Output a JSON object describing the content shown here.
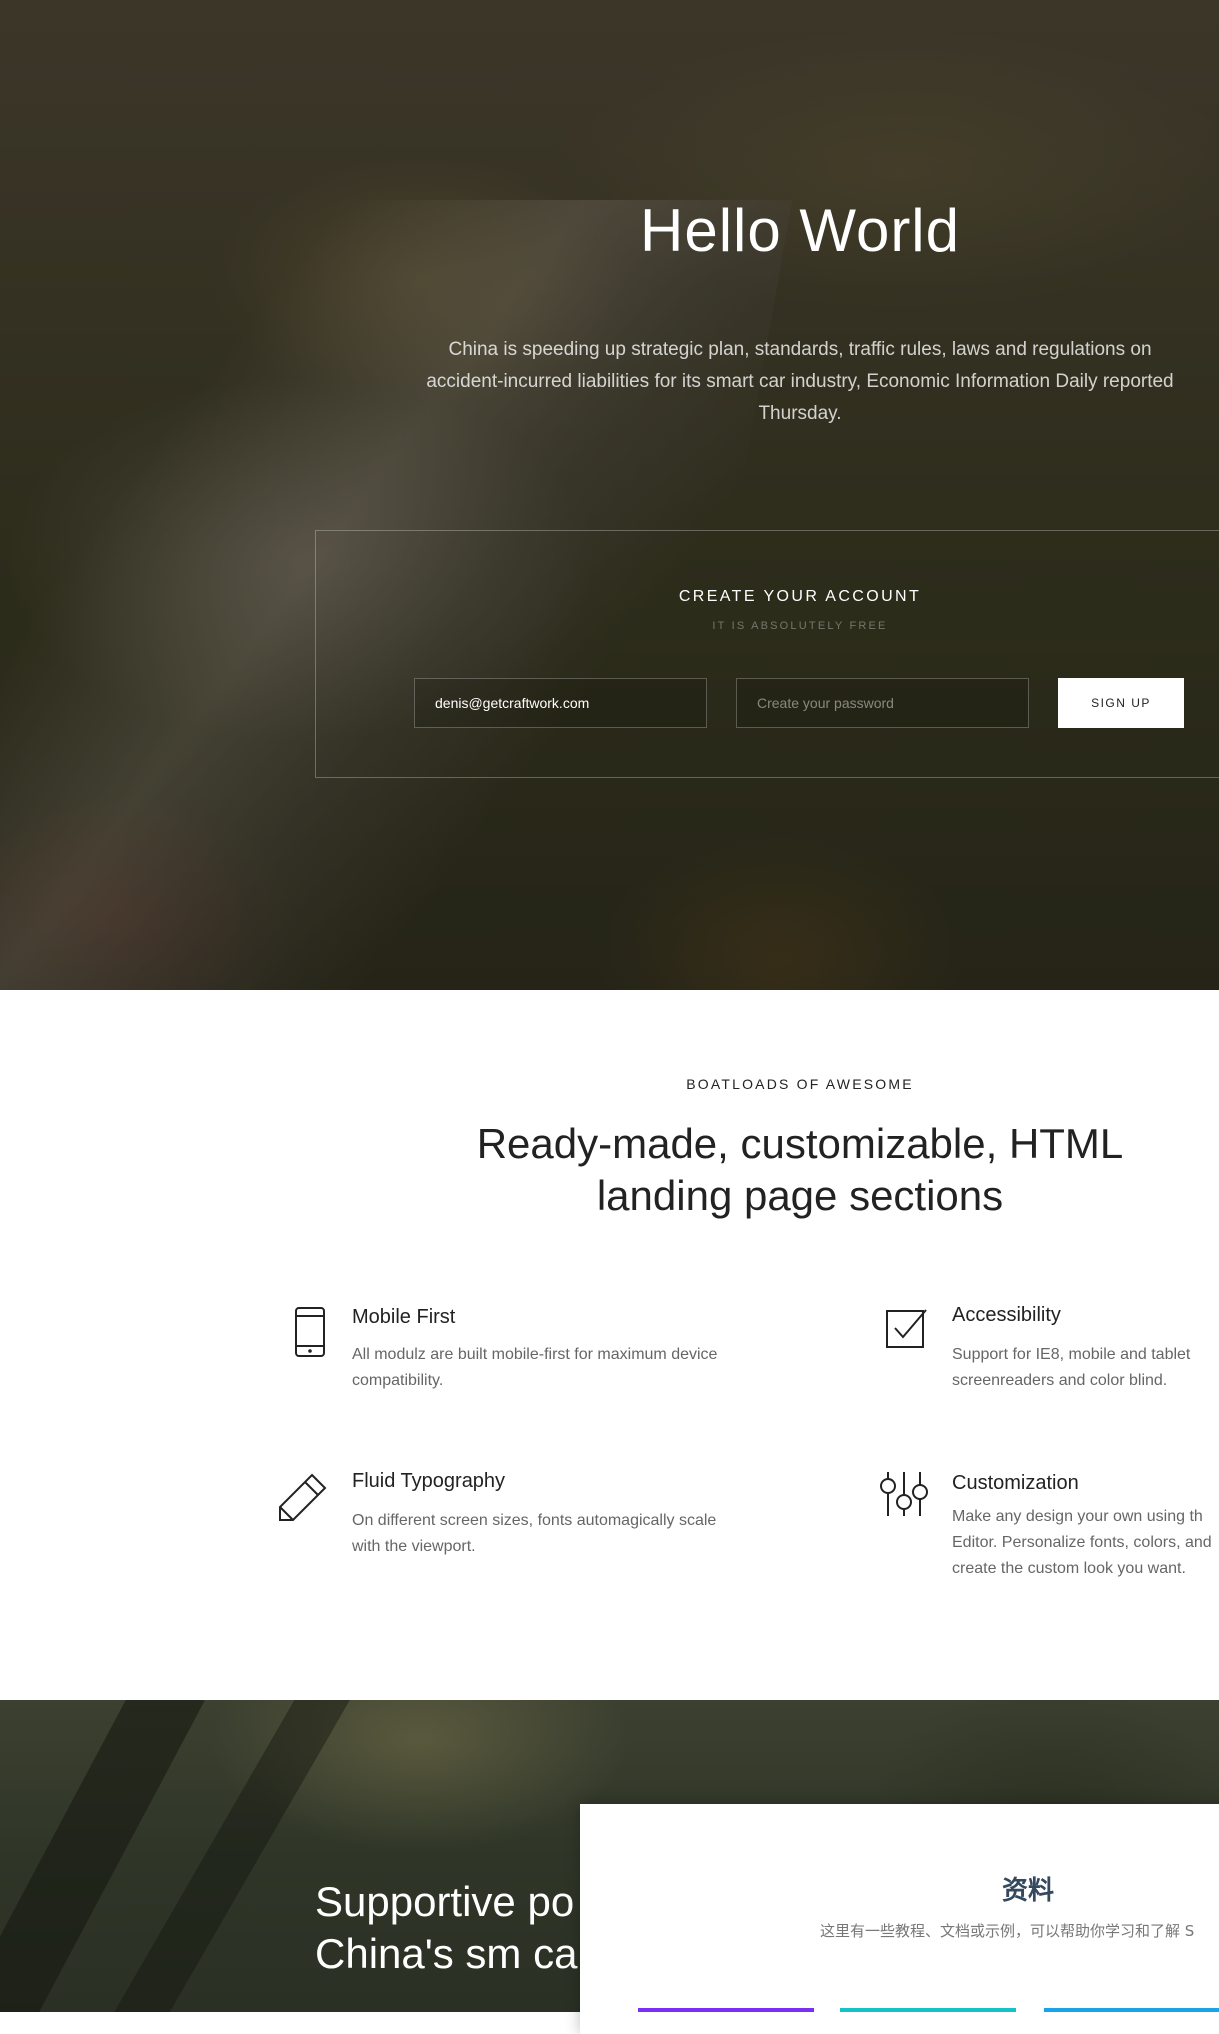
{
  "hero": {
    "title": "Hello World",
    "text": "China is speeding up strategic plan, standards, traffic rules, laws and regulations on accident-incurred liabilities for its smart car industry, Economic Information Daily reported Thursday.",
    "signup": {
      "title": "CREATE YOUR ACCOUNT",
      "subtitle": "IT IS ABSOLUTELY FREE",
      "email_value": "denis@getcraftwork.com",
      "password_placeholder": "Create your password",
      "button_label": "SIGN UP"
    }
  },
  "features": {
    "eyebrow": "BOATLOADS OF AWESOME",
    "title": "Ready-made, customizable, HTML landing page sections",
    "items": [
      {
        "icon": "mobile-phone-icon",
        "title": "Mobile First",
        "text": "All modulz are built mobile-first for maximum device compatibility."
      },
      {
        "icon": "checkbox-icon",
        "title": "Accessibility",
        "text": "Support for IE8, mobile and tablet screenreaders and color blind."
      },
      {
        "icon": "pencil-icon",
        "title": "Fluid Typography",
        "text": "On different screen sizes, fonts automagically scale with the viewport."
      },
      {
        "icon": "sliders-icon",
        "title": "Customization",
        "text": "Make any design your own using th Editor. Personalize fonts, colors, and create the custom look you want."
      }
    ]
  },
  "bottom": {
    "title": "Supportive po for China's sm car"
  },
  "popup": {
    "title": "资料",
    "text": "这里有一些教程、文档或示例，可以帮助你学习和了解 S",
    "button_colors": [
      "#7b2ff2",
      "#16c1c8",
      "#1aa3e8"
    ]
  }
}
